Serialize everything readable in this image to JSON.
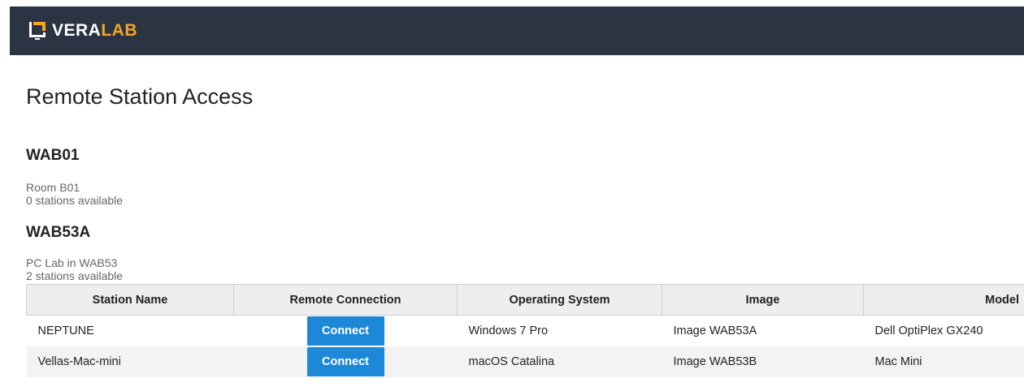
{
  "brand": {
    "name_part1": "VERA",
    "name_part2": "LAB",
    "logo_icon": "monitor-icon"
  },
  "page": {
    "title": "Remote Station Access"
  },
  "rooms": [
    {
      "name": "WAB01",
      "description": "Room B01",
      "availability": "0 stations available"
    },
    {
      "name": "WAB53A",
      "description": "PC Lab in WAB53",
      "availability": "2 stations available"
    }
  ],
  "table": {
    "headers": [
      "Station Name",
      "Remote Connection",
      "Operating System",
      "Image",
      "Model"
    ],
    "rows": [
      {
        "station": "NEPTUNE",
        "action": "Connect",
        "os": "Windows 7 Pro",
        "image": "Image WAB53A",
        "model": "Dell OptiPlex GX240"
      },
      {
        "station": "Vellas-Mac-mini",
        "action": "Connect",
        "os": "macOS Catalina",
        "image": "Image WAB53B",
        "model": "Mac Mini"
      }
    ]
  },
  "colors": {
    "header_bg": "#2a3442",
    "brand_accent": "#f5a623",
    "button": "#1e88d8"
  }
}
